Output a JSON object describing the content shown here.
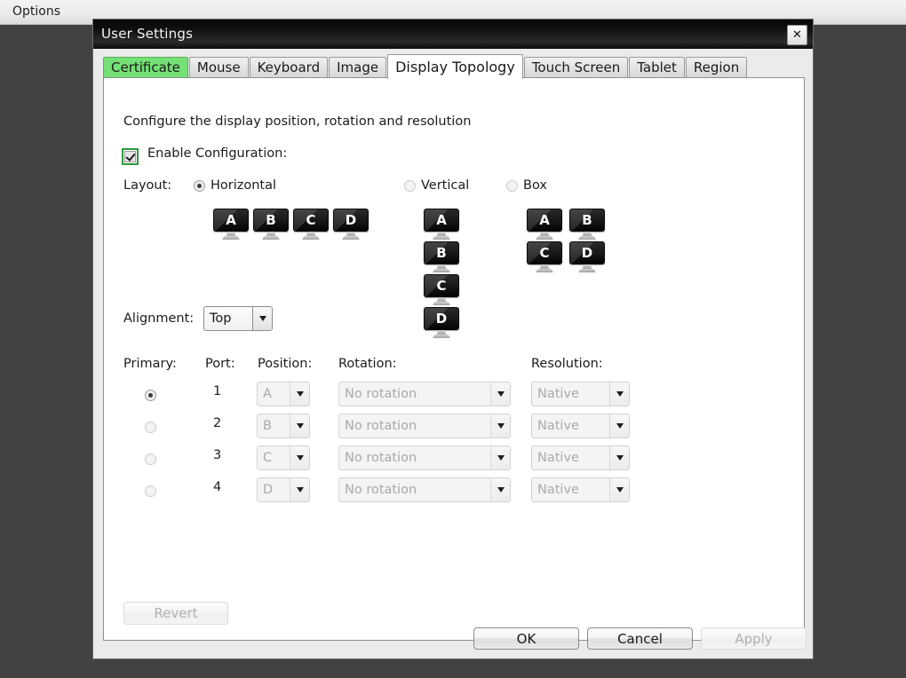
{
  "menubar": {
    "options_label": "Options"
  },
  "dialog": {
    "title": "User Settings",
    "close_icon": "✕"
  },
  "tabs": [
    {
      "label": "Certificate",
      "state": "highlighted"
    },
    {
      "label": "Mouse",
      "state": "normal"
    },
    {
      "label": "Keyboard",
      "state": "normal"
    },
    {
      "label": "Image",
      "state": "normal"
    },
    {
      "label": "Display Topology",
      "state": "active"
    },
    {
      "label": "Touch Screen",
      "state": "normal"
    },
    {
      "label": "Tablet",
      "state": "normal"
    },
    {
      "label": "Region",
      "state": "normal"
    }
  ],
  "panel": {
    "description": "Configure the display position, rotation and resolution",
    "enable_label": "Enable Configuration:",
    "enable_checked": true,
    "layout_label": "Layout:",
    "layout_options": [
      {
        "label": "Horizontal",
        "selected": true
      },
      {
        "label": "Vertical",
        "selected": false
      },
      {
        "label": "Box",
        "selected": false
      }
    ],
    "monitor_letters": {
      "a": "A",
      "b": "B",
      "c": "C",
      "d": "D"
    },
    "alignment_label": "Alignment:",
    "alignment_value": "Top",
    "columns": {
      "primary": "Primary:",
      "port": "Port:",
      "position": "Position:",
      "rotation": "Rotation:",
      "resolution": "Resolution:"
    },
    "rows": [
      {
        "primary_selected": true,
        "port": "1",
        "position": "A",
        "rotation": "No rotation",
        "resolution": "Native"
      },
      {
        "primary_selected": false,
        "port": "2",
        "position": "B",
        "rotation": "No rotation",
        "resolution": "Native"
      },
      {
        "primary_selected": false,
        "port": "3",
        "position": "C",
        "rotation": "No rotation",
        "resolution": "Native"
      },
      {
        "primary_selected": false,
        "port": "4",
        "position": "D",
        "rotation": "No rotation",
        "resolution": "Native"
      }
    ],
    "revert_label": "Revert",
    "revert_enabled": false
  },
  "footer": {
    "ok_label": "OK",
    "cancel_label": "Cancel",
    "apply_label": "Apply",
    "apply_enabled": false
  },
  "colors": {
    "desktop": "#424242",
    "tab_highlight": "#75e075",
    "checkbox_focus": "#2f9b3f",
    "monitor_screen": "#111111"
  }
}
